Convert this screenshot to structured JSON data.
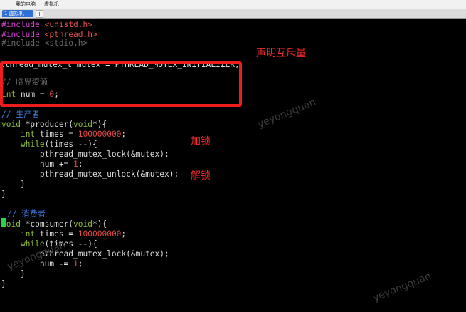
{
  "menu": {
    "items": [
      "我的电脑",
      "虚拟机"
    ]
  },
  "tabs": {
    "active_label": "1 虚拟机",
    "add_label": "+"
  },
  "code": {
    "l1_directive": "#include",
    "l1_header": "<unistd.h>",
    "l2_directive": "#include",
    "l2_header": "<pthread.h>",
    "l3_partial": "#include <stdio.h>",
    "l5_text": "pthread_mutex_t mutex = PTHREAD_MUTEX_INITIALIZER;",
    "l7_partial": "// 临界资源",
    "l8_type": "int",
    "l8_text": " num = ",
    "l8_num": "0",
    "l8_end": ";",
    "l10_comment": "// 生产者",
    "l11_a": "void",
    "l11_b": " *producer(",
    "l11_c": "void",
    "l11_d": "*){",
    "l12_indent": "    ",
    "l12_type": "int",
    "l12_text": " times = ",
    "l12_num": "100000000",
    "l12_end": ";",
    "l13_indent": "    ",
    "l13_kw": "while",
    "l13_text": "(times --){",
    "l14_text": "        pthread_mutex_lock(&mutex);",
    "l15_text": "        num += ",
    "l15_num": "1",
    "l15_end": ";",
    "l16_text": "        pthread_mutex_unlock(&mutex);",
    "l17_text": "    }",
    "l18_text": "}",
    "l20_comment": "// 消费者",
    "l21_a": "void",
    "l21_b": " *comsumer(",
    "l21_c": "void",
    "l21_d": "*){",
    "l22_indent": "    ",
    "l22_type": "int",
    "l22_text": " times = ",
    "l22_num": "100000000",
    "l22_end": ";",
    "l23_indent": "    ",
    "l23_kw": "while",
    "l23_text": "(times --){",
    "l24_text": "        pthread_mutex_lock(&mutex);",
    "l25_text": "        num -= ",
    "l25_num": "1",
    "l25_end": ";",
    "l26_text": "    }",
    "l27_text": "}"
  },
  "annotations": {
    "declare_mutex": "声明互斥量",
    "lock": "加锁",
    "unlock": "解锁"
  },
  "watermark": "yeyongquan",
  "colors": {
    "highlight_border": "#ee1d1d",
    "cursor": "#29d34d",
    "annotation": "#ee2a2a"
  }
}
